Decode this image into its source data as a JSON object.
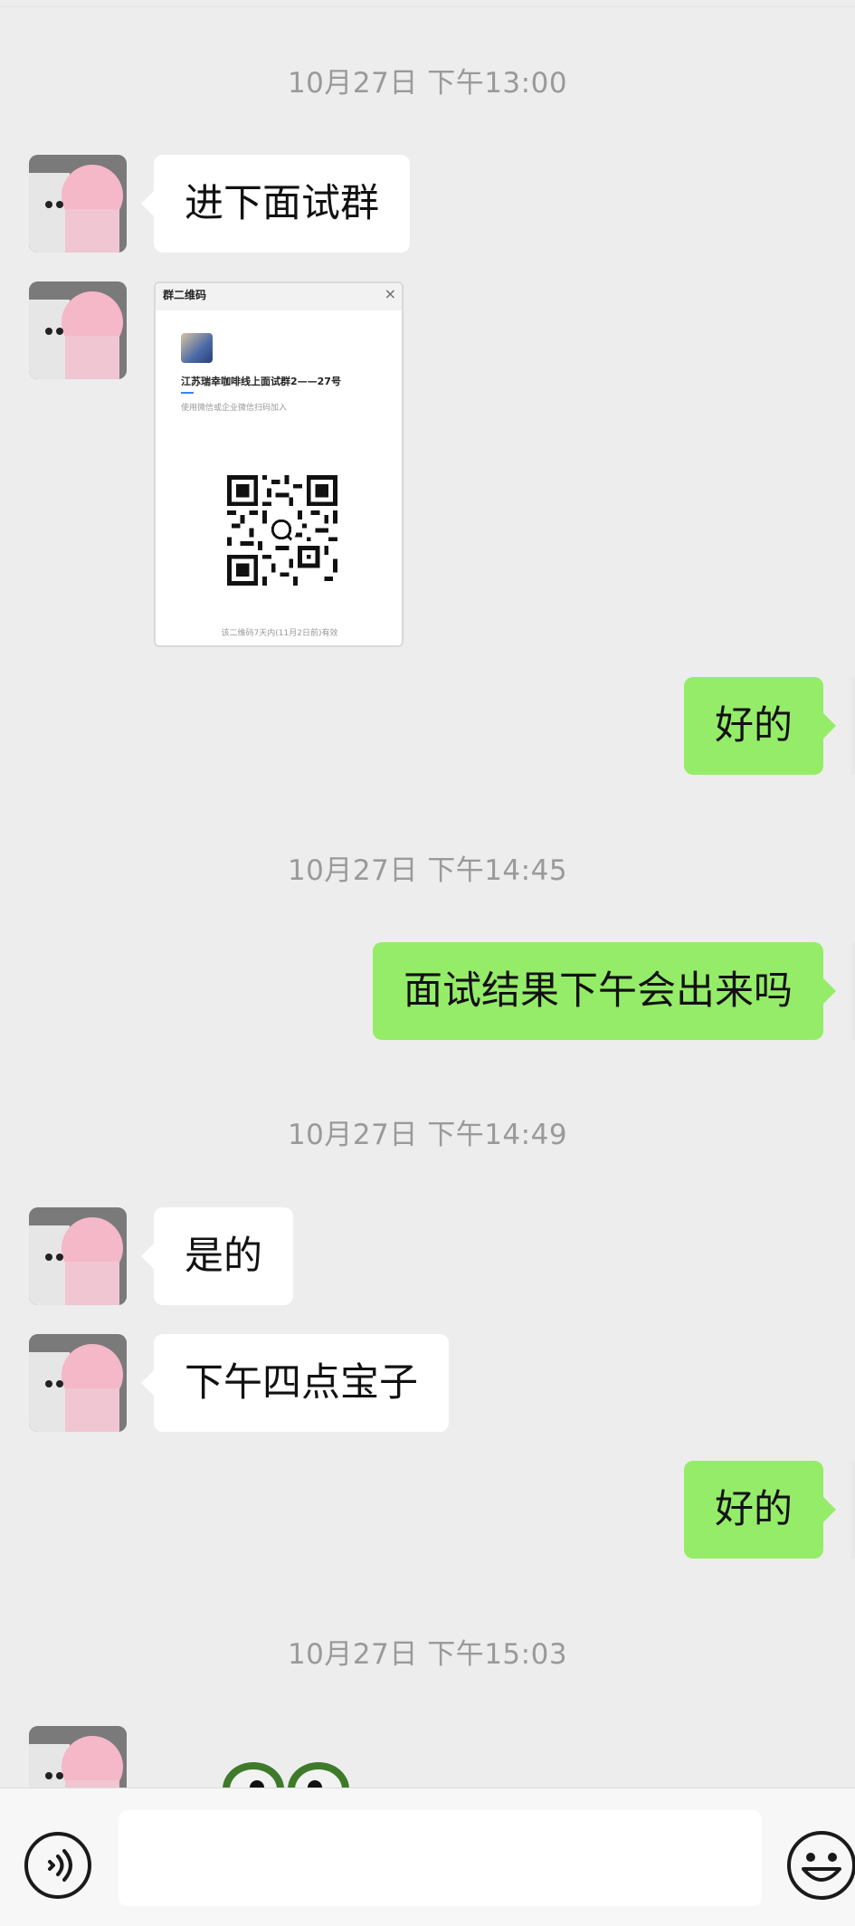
{
  "messages": [
    {
      "type": "time",
      "text": "10月27日 下午13:00"
    },
    {
      "type": "text",
      "side": "left",
      "text": "进下面试群"
    },
    {
      "type": "image",
      "side": "left",
      "card": {
        "header": "群二维码",
        "close": "×",
        "group_name": "江苏瑞幸咖啡线上面试群2——27号",
        "instruction": "使用微信或企业微信扫码加入",
        "validity": "该二维码7天内(11月2日前)有效"
      }
    },
    {
      "type": "text",
      "side": "right",
      "text": "好的"
    },
    {
      "type": "time",
      "text": "10月27日 下午14:45"
    },
    {
      "type": "text",
      "side": "right",
      "text": "面试结果下午会出来吗"
    },
    {
      "type": "time",
      "text": "10月27日 下午14:49"
    },
    {
      "type": "text",
      "side": "left",
      "text": "是的"
    },
    {
      "type": "text",
      "side": "left",
      "text": "下午四点宝子"
    },
    {
      "type": "text",
      "side": "right",
      "text": "好的"
    },
    {
      "type": "time",
      "text": "10月27日 下午15:03"
    },
    {
      "type": "sticker",
      "side": "left",
      "icon": "frog-sticker"
    }
  ],
  "input_bar": {
    "voice_icon": "voice-icon",
    "emoji_icon": "emoji-icon",
    "input_value": ""
  },
  "colors": {
    "background": "#ededed",
    "self_bubble": "#95ec69",
    "other_bubble": "#ffffff",
    "timestamp": "#9a9a9a"
  }
}
